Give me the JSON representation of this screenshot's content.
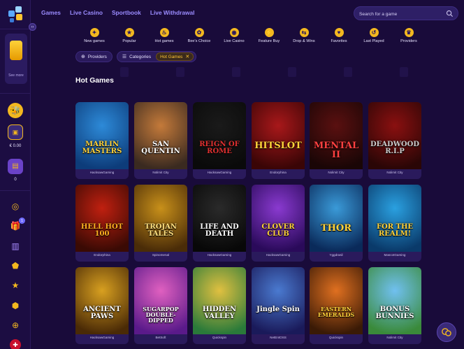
{
  "nav": {
    "links": [
      "Games",
      "Live Casino",
      "Sportbook",
      "Live Withdrawal"
    ],
    "search_placeholder": "Search for a game"
  },
  "sidebar": {
    "see_more": "See more",
    "balance": "€ 0.00",
    "count": "0",
    "gift_badge": "1"
  },
  "categories": [
    "New games",
    "Popular",
    "Hot games",
    "Bee's Choice",
    "Live Casino",
    "Feature Buy",
    "Drop & Wins",
    "Favorites",
    "Last Played",
    "Providers"
  ],
  "filters": {
    "providers": "Providers",
    "categories": "Categories",
    "active": "Hot Games"
  },
  "section_title": "Hot Games",
  "games": [
    {
      "title": "MARLIN MASTERS",
      "provider": "HacksawGaming",
      "bg": [
        "#2d8ad8",
        "#0d3c7a"
      ],
      "color": "#ffd23a"
    },
    {
      "title": "SAN QUENTIN",
      "provider": "Nolimit City",
      "bg": [
        "#c47a3a",
        "#3a2a20"
      ],
      "color": "#ffffff"
    },
    {
      "title": "REIGN OF ROME",
      "provider": "HacksawGaming",
      "bg": [
        "#1a1a1a",
        "#0a0a0a"
      ],
      "color": "#e03030"
    },
    {
      "title": "HITSLOT",
      "provider": "Endorphina",
      "bg": [
        "#a8181a",
        "#3a0506"
      ],
      "color": "#ffd23a"
    },
    {
      "title": "MENTAL II",
      "provider": "Nolimit City",
      "bg": [
        "#5a1010",
        "#1a0606"
      ],
      "color": "#ff4040"
    },
    {
      "title": "DEADWOOD R.I.P",
      "provider": "Nolimit City",
      "bg": [
        "#8a1010",
        "#2a0606"
      ],
      "color": "#cccccc"
    },
    {
      "title": "HELL HOT 100",
      "provider": "Endorphina",
      "bg": [
        "#c02010",
        "#3a0a04"
      ],
      "color": "#ffb020"
    },
    {
      "title": "TROJAN TALES",
      "provider": "Spinomenal",
      "bg": [
        "#c8901a",
        "#4a2c08"
      ],
      "color": "#ffe080"
    },
    {
      "title": "LIFE AND DEATH",
      "provider": "HacksawGaming",
      "bg": [
        "#2a2a2a",
        "#080808"
      ],
      "color": "#ffffff"
    },
    {
      "title": "CLOVER CLUB",
      "provider": "HacksawGaming",
      "bg": [
        "#8a3ad0",
        "#2a0a5a"
      ],
      "color": "#ffd23a"
    },
    {
      "title": "THOR",
      "provider": "Yggdrasil",
      "bg": [
        "#3a9ad8",
        "#0a2a5a"
      ],
      "color": "#ffd23a"
    },
    {
      "title": "FOR THE REALM!",
      "provider": "MascotGaming",
      "bg": [
        "#2aa0e0",
        "#0a3a6a"
      ],
      "color": "#ffd23a"
    },
    {
      "title": "ANCIENT PAWS",
      "provider": "HacksawGaming",
      "bg": [
        "#d8a020",
        "#4a2a06"
      ],
      "color": "#ffffff"
    },
    {
      "title": "SUGARPOP DOUBLE-DIPPED",
      "provider": "BetSoft",
      "bg": [
        "#e060c0",
        "#5a1a8a"
      ],
      "color": "#ffffff"
    },
    {
      "title": "HIDDEN VALLEY",
      "provider": "Quickspin",
      "bg": [
        "#e0c040",
        "#2a7a3a"
      ],
      "color": "#ffffff"
    },
    {
      "title": "Jingle Spin",
      "provider": "NetEntOSS",
      "bg": [
        "#4a7ad0",
        "#1a1a5a"
      ],
      "color": "#ffffff"
    },
    {
      "title": "EASTERN EMERALDS",
      "provider": "Quickspin",
      "bg": [
        "#e07020",
        "#3a1a06"
      ],
      "color": "#ffd23a"
    },
    {
      "title": "BONUS BUNNIES",
      "provider": "Nolimit City",
      "bg": [
        "#70c0f0",
        "#3a8a3a"
      ],
      "color": "#ffffff"
    }
  ]
}
